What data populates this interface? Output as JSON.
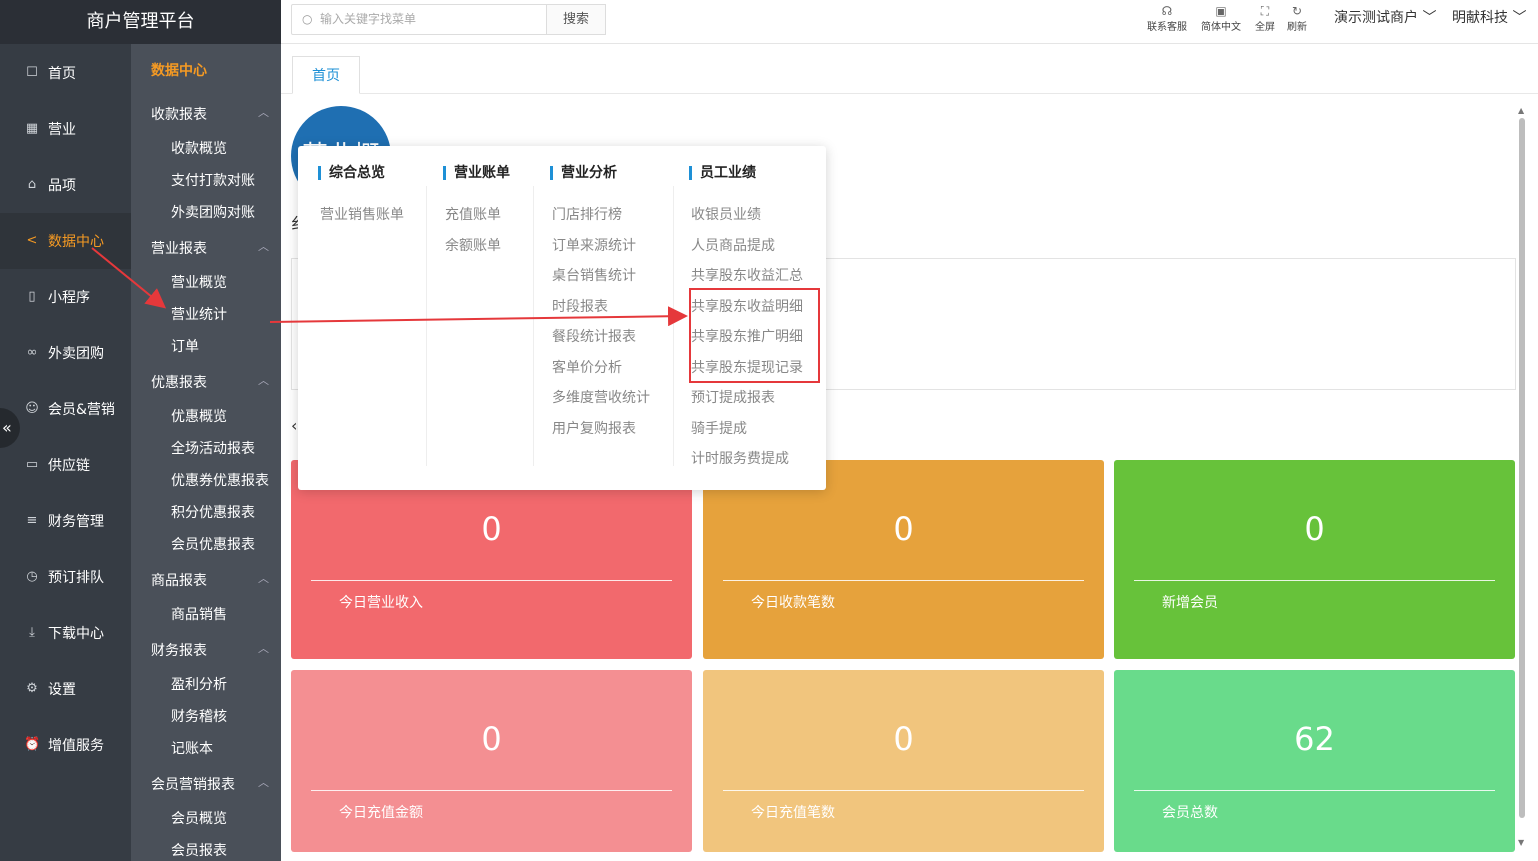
{
  "app": {
    "title": "商户管理平台"
  },
  "sidebar": {
    "items": [
      {
        "icon": "home-icon",
        "glyph": "☐",
        "label": "首页"
      },
      {
        "icon": "calendar-icon",
        "glyph": "▦",
        "label": "营业"
      },
      {
        "icon": "bag-icon",
        "glyph": "⌂",
        "label": "品项"
      },
      {
        "icon": "share-icon",
        "glyph": "<",
        "label": "数据中心"
      },
      {
        "icon": "phone-icon",
        "glyph": "▯",
        "label": "小程序"
      },
      {
        "icon": "bike-icon",
        "glyph": "∞",
        "label": "外卖团购"
      },
      {
        "icon": "user-icon",
        "glyph": "☺",
        "label": "会员&营销"
      },
      {
        "icon": "truck-icon",
        "glyph": "▭",
        "label": "供应链"
      },
      {
        "icon": "database-icon",
        "glyph": "≡",
        "label": "财务管理"
      },
      {
        "icon": "clock-icon",
        "glyph": "◷",
        "label": "预订排队"
      },
      {
        "icon": "download-icon",
        "glyph": "⤓",
        "label": "下载中心"
      },
      {
        "icon": "gear-icon",
        "glyph": "⚙",
        "label": "设置"
      },
      {
        "icon": "alarm-icon",
        "glyph": "⏰",
        "label": "增值服务"
      }
    ],
    "collapse": "«"
  },
  "submenu": {
    "title": "数据中心",
    "groups": [
      {
        "label": "收款报表",
        "arrow": "︿",
        "items": [
          "收款概览",
          "支付打款对账",
          "外卖团购对账"
        ]
      },
      {
        "label": "营业报表",
        "arrow": "︿",
        "items": [
          "营业概览",
          "营业统计",
          "订单"
        ]
      },
      {
        "label": "优惠报表",
        "arrow": "︿",
        "items": [
          "优惠概览",
          "全场活动报表",
          "优惠券优惠报表",
          "积分优惠报表",
          "会员优惠报表"
        ]
      },
      {
        "label": "商品报表",
        "arrow": "︿",
        "items": [
          "商品销售"
        ]
      },
      {
        "label": "财务报表",
        "arrow": "︿",
        "items": [
          "盈利分析",
          "财务稽核",
          "记账本"
        ]
      },
      {
        "label": "会员营销报表",
        "arrow": "︿",
        "items": [
          "会员概览",
          "会员报表"
        ]
      }
    ]
  },
  "header": {
    "search_placeholder": "输入关键字找菜单",
    "search_button": "搜索",
    "icons": [
      {
        "icon": "headset-icon",
        "glyph": "☊",
        "label": "联系客服"
      },
      {
        "icon": "translate-icon",
        "glyph": "▣",
        "label": "简体中文"
      },
      {
        "icon": "fullscreen-icon",
        "glyph": "⛶",
        "label": "全屏"
      },
      {
        "icon": "refresh-icon",
        "glyph": "↻",
        "label": "刷新"
      }
    ],
    "merchant": "演示测试商户 ﹀",
    "company": "明献科技 ﹀"
  },
  "tabs": [
    {
      "label": "首页"
    }
  ],
  "avatar_text": "营业概",
  "mega": {
    "columns": [
      {
        "head": "综合总览",
        "items": [
          "营业销售账单"
        ]
      },
      {
        "head": "营业账单",
        "items": [
          "充值账单",
          "余额账单"
        ]
      },
      {
        "head": "营业分析",
        "items": [
          "门店排行榜",
          "订单来源统计",
          "桌台销售统计",
          "时段报表",
          "餐段统计报表",
          "客单价分析",
          "多维度营收统计",
          "用户复购报表"
        ]
      },
      {
        "head": "员工业绩",
        "items": [
          "收银员业绩",
          "人员商品提成",
          "共享股东收益汇总",
          "共享股东收益明细",
          "共享股东推广明细",
          "共享股东提现记录",
          "预订提成报表",
          "骑手提成",
          "计时服务费提成"
        ]
      }
    ]
  },
  "cards": [
    {
      "value": "0",
      "label": "今日营业收入",
      "color": "#f2696d"
    },
    {
      "value": "0",
      "label": "今日收款笔数",
      "color": "#e6a23c"
    },
    {
      "value": "0",
      "label": "新增会员",
      "color": "#67c23a"
    },
    {
      "value": "0",
      "label": "今日充值金额",
      "color": "#f48f92"
    },
    {
      "value": "0",
      "label": "今日充值笔数",
      "color": "#f1c57d"
    },
    {
      "value": "62",
      "label": "会员总数",
      "color": "#69db8b"
    }
  ],
  "annotation_color": "#e5383b"
}
